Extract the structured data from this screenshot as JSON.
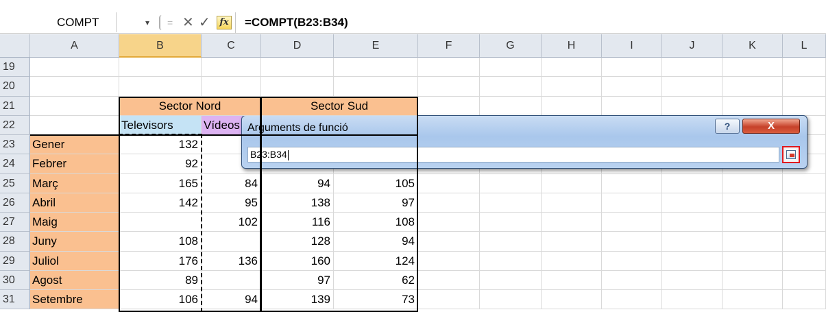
{
  "formula_bar": {
    "name_box": "COMPT",
    "dropdown_glyph": "▾",
    "separator_glyph": "=",
    "cancel_glyph": "✕",
    "enter_glyph": "✓",
    "fx_label": "fx",
    "formula": "=COMPT(B23:B34)"
  },
  "columns": [
    "A",
    "B",
    "C",
    "D",
    "E",
    "F",
    "G",
    "H",
    "I",
    "J",
    "K",
    "L"
  ],
  "selected_column": "B",
  "rows": [
    "19",
    "20",
    "21",
    "22",
    "23",
    "24",
    "25",
    "26",
    "27",
    "28",
    "29",
    "30",
    "31"
  ],
  "headers": {
    "sector_nord": "Sector Nord",
    "sector_sud": "Sector Sud",
    "televisors": "Televisors",
    "videos": "Vídeos"
  },
  "months": [
    "Gener",
    "Febrer",
    "Març",
    "Abril",
    "Maig",
    "Juny",
    "Juliol",
    "Agost",
    "Setembre"
  ],
  "table": [
    {
      "B": "132",
      "C": "",
      "D": "",
      "E": ""
    },
    {
      "B": "92",
      "C": "",
      "D": "",
      "E": ""
    },
    {
      "B": "165",
      "C": "84",
      "D": "94",
      "E": "105"
    },
    {
      "B": "142",
      "C": "95",
      "D": "138",
      "E": "97"
    },
    {
      "B": "",
      "C": "102",
      "D": "116",
      "E": "108"
    },
    {
      "B": "108",
      "C": "",
      "D": "128",
      "E": "94"
    },
    {
      "B": "176",
      "C": "136",
      "D": "160",
      "E": "124"
    },
    {
      "B": "89",
      "C": "",
      "D": "97",
      "E": "62"
    },
    {
      "B": "106",
      "C": "94",
      "D": "139",
      "E": "73"
    }
  ],
  "dialog": {
    "title": "Arguments de funció",
    "help_glyph": "?",
    "close_glyph": "X",
    "input_value": "B23:B34"
  },
  "colors": {
    "orange_fill": "#fac090",
    "blue_fill": "#c5e3f5",
    "purple_fill": "#ddb3f2",
    "selected_header": "#f7d48a",
    "expand_button_highlight": "#e0181e"
  }
}
